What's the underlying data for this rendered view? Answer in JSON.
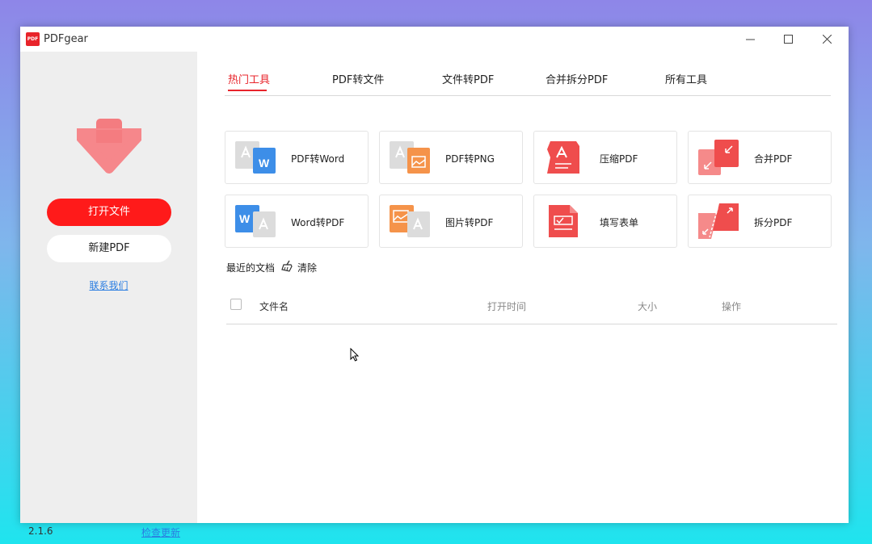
{
  "window": {
    "title": "PDFgear",
    "logo_text": "PDF"
  },
  "sidebar": {
    "open_file": "打开文件",
    "new_pdf": "新建PDF",
    "contact": "联系我们",
    "version": "2.1.6",
    "check_update": "检查更新"
  },
  "tabs": [
    "热门工具",
    "PDF转文件",
    "文件转PDF",
    "合并拆分PDF",
    "所有工具"
  ],
  "tools": [
    {
      "label": "PDF转Word",
      "icon": "pdf-to-word-icon"
    },
    {
      "label": "PDF转PNG",
      "icon": "pdf-to-png-icon"
    },
    {
      "label": "压缩PDF",
      "icon": "compress-pdf-icon"
    },
    {
      "label": "合并PDF",
      "icon": "merge-pdf-icon"
    },
    {
      "label": "Word转PDF",
      "icon": "word-to-pdf-icon"
    },
    {
      "label": "图片转PDF",
      "icon": "image-to-pdf-icon"
    },
    {
      "label": "填写表单",
      "icon": "fill-form-icon"
    },
    {
      "label": "拆分PDF",
      "icon": "split-pdf-icon"
    }
  ],
  "recent": {
    "title": "最近的文档",
    "clear": "清除",
    "columns": [
      "文件名",
      "打开时间",
      "大小",
      "操作"
    ]
  },
  "colors": {
    "accent": "#e8242b",
    "link": "#2a7de1",
    "word_blue": "#3d8ee8",
    "png_orange": "#f5934a"
  }
}
